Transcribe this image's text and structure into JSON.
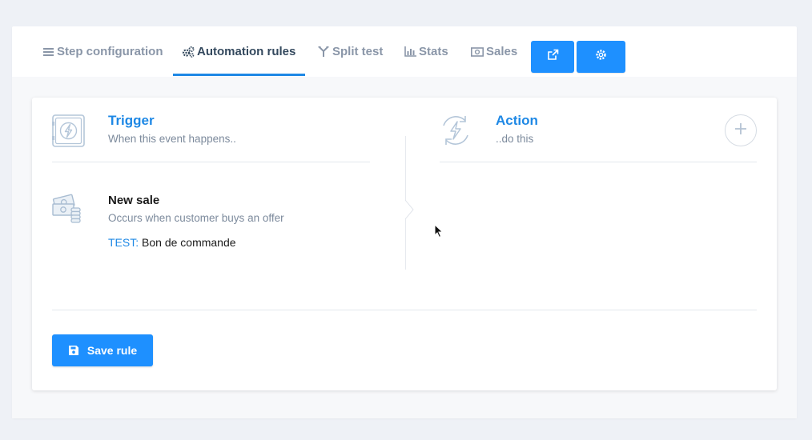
{
  "tabs": [
    {
      "label": "Step configuration",
      "icon": "list-icon",
      "active": false
    },
    {
      "label": "Automation rules",
      "icon": "gears-icon",
      "active": true
    },
    {
      "label": "Split test",
      "icon": "split-icon",
      "active": false
    },
    {
      "label": "Stats",
      "icon": "bar-chart-icon",
      "active": false
    },
    {
      "label": "Sales",
      "icon": "money-icon",
      "active": false
    }
  ],
  "header_buttons": [
    {
      "icon": "external-link-icon"
    },
    {
      "icon": "settings-gear-icon"
    }
  ],
  "trigger": {
    "title": "Trigger",
    "subtitle": "When this event happens..",
    "icon": "lightning-box-icon"
  },
  "action": {
    "title": "Action",
    "subtitle": "..do this",
    "icon": "lightning-refresh-icon",
    "add_icon": "plus-icon"
  },
  "event": {
    "icon": "money-stack-icon",
    "title": "New sale",
    "description": "Occurs when customer buys an offer",
    "test_key": "TEST",
    "test_value": "Bon de commande"
  },
  "save": {
    "label": "Save rule",
    "icon": "floppy-disk-icon"
  },
  "colors": {
    "accent": "#1e88e5",
    "button": "#1e90ff",
    "page_bg": "#eef1f6"
  }
}
